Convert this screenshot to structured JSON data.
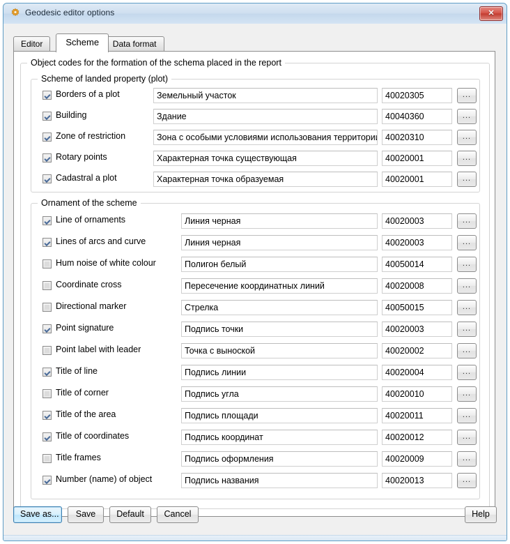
{
  "window": {
    "title": "Geodesic editor options",
    "icon": "gear-icon",
    "close_label": "✕",
    "accent": "#5f9cc5"
  },
  "tabs": [
    {
      "label": "Editor",
      "active": false
    },
    {
      "label": "Scheme",
      "active": true
    },
    {
      "label": "Data format",
      "active": false
    }
  ],
  "groups": {
    "outer_legend": "Object codes for the formation of the schema placed in the report",
    "plot_legend": "Scheme of landed property (plot)",
    "ornament_legend": "Ornament of the scheme"
  },
  "browse_button_label": "...",
  "plot_rows": [
    {
      "label": "Borders of a plot",
      "checked": true,
      "name": "Земельный участок",
      "code": "40020305"
    },
    {
      "label": "Building",
      "checked": true,
      "name": "Здание",
      "code": "40040360"
    },
    {
      "label": "Zone of restriction",
      "checked": true,
      "name": "Зона с особыми условиями использования территории",
      "code": "40020310"
    },
    {
      "label": "Rotary points",
      "checked": true,
      "name": "Характерная точка существующая",
      "code": "40020001"
    },
    {
      "label": "Cadastral a plot",
      "checked": true,
      "name": "Характерная точка образуемая",
      "code": "40020001"
    }
  ],
  "ornament_rows": [
    {
      "label": "Line of ornaments",
      "checked": true,
      "name": "Линия черная",
      "code": "40020003"
    },
    {
      "label": "Lines of arcs and curve",
      "checked": true,
      "name": "Линия черная",
      "code": "40020003"
    },
    {
      "label": "Hum noise of white colour",
      "checked": false,
      "name": "Полигон белый",
      "code": "40050014"
    },
    {
      "label": "Coordinate cross",
      "checked": false,
      "name": "Пересечение координатных линий",
      "code": "40020008"
    },
    {
      "label": "Directional marker",
      "checked": false,
      "name": "Стрелка",
      "code": "40050015"
    },
    {
      "label": "Point signature",
      "checked": true,
      "name": "Подпись точки",
      "code": "40020003"
    },
    {
      "label": "Point label with leader",
      "checked": false,
      "name": "Точка с выноской",
      "code": "40020002"
    },
    {
      "label": "Title of line",
      "checked": true,
      "name": "Подпись линии",
      "code": "40020004"
    },
    {
      "label": "Title of corner",
      "checked": false,
      "name": "Подпись угла",
      "code": "40020010"
    },
    {
      "label": "Title of the area",
      "checked": true,
      "name": "Подпись площади",
      "code": "40020011"
    },
    {
      "label": "Title of coordinates",
      "checked": true,
      "name": "Подпись координат",
      "code": "40020012"
    },
    {
      "label": "Title frames",
      "checked": false,
      "name": "Подпись оформления",
      "code": "40020009"
    },
    {
      "label": "Number (name) of object",
      "checked": true,
      "name": "Подпись названия",
      "code": "40020013"
    }
  ],
  "buttons": {
    "save_as": "Save as...",
    "save": "Save",
    "default": "Default",
    "cancel": "Cancel",
    "help": "Help"
  }
}
